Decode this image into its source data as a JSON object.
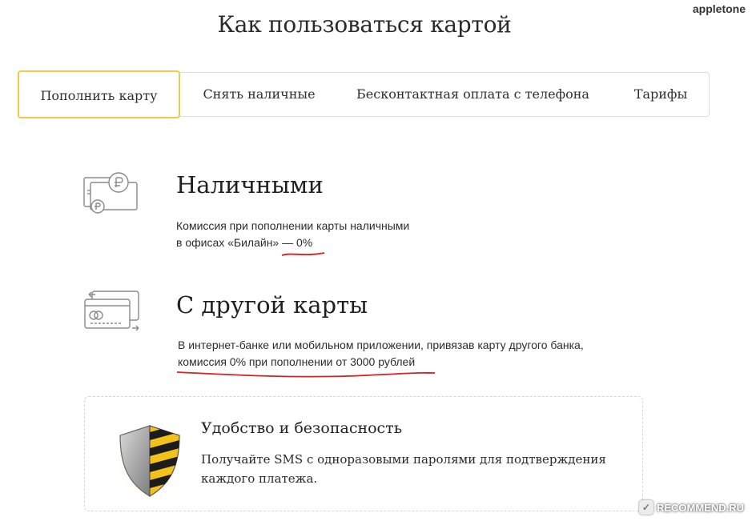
{
  "header": {
    "title": "Как пользоваться картой",
    "username": "appletone"
  },
  "tabs": [
    {
      "label": "Пополнить карту",
      "active": true
    },
    {
      "label": "Снять наличные",
      "active": false
    },
    {
      "label": "Бесконтактная оплата с телефона",
      "active": false
    },
    {
      "label": "Тарифы",
      "active": false
    }
  ],
  "methods": {
    "cash": {
      "icon": "cash-rouble-icon",
      "title": "Наличными",
      "line1": "Комиссия при пополнении карты наличными",
      "line2": "в офисах «Билайн» — 0%"
    },
    "card": {
      "icon": "card-transfer-icon",
      "title": "С другой карты",
      "line1": "В интернет-банке или мобильном приложении, привязав карту другого банка,",
      "line2": "комиссия 0% при пополнении от 3000 рублей"
    }
  },
  "promo": {
    "icon": "shield-icon",
    "title": "Удобство и безопасность",
    "text": "Получайте SMS с одноразовыми паролями для подтверждения каждого платежа."
  },
  "watermark": "RECOMMEND.RU",
  "colors": {
    "accent_yellow": "#f0c84a",
    "annotation_red": "#d81e1e",
    "shield_yellow": "#f3c21a",
    "text": "#222222"
  }
}
